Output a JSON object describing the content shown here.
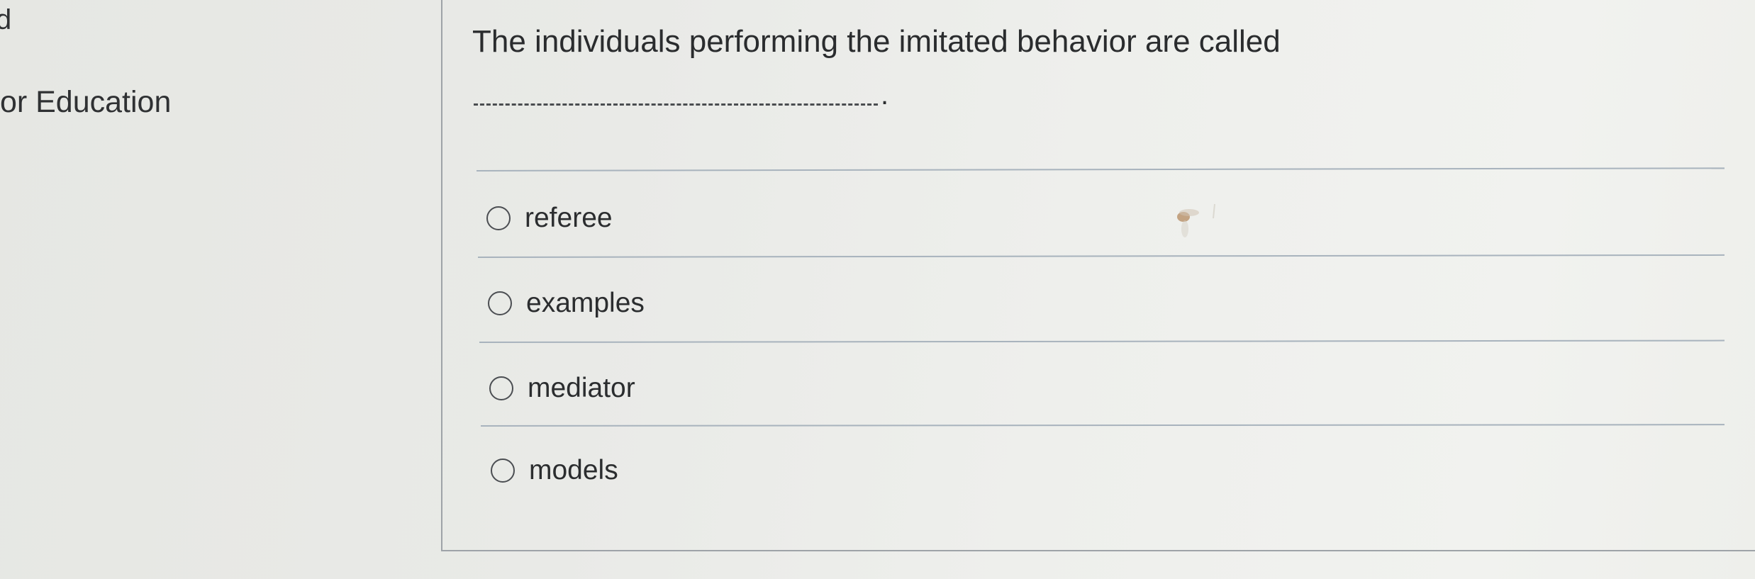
{
  "sidebar": {
    "fragment_text": "d",
    "course_label": "for Education"
  },
  "question": {
    "text": "The individuals performing the imitated behavior are called",
    "blank_suffix": ".",
    "options": [
      {
        "label": "referee",
        "selected": false
      },
      {
        "label": "examples",
        "selected": false
      },
      {
        "label": "mediator",
        "selected": false
      },
      {
        "label": "models",
        "selected": false
      }
    ]
  },
  "colors": {
    "background": "#eceeea",
    "text": "#2b2d2f",
    "divider": "#a8b3bd",
    "panel_border": "#9ea3a8"
  }
}
